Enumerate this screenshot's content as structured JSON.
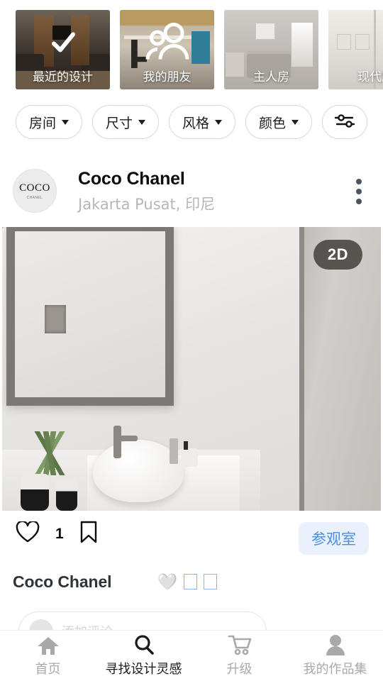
{
  "categories": [
    {
      "label": "最近的设计",
      "overlay_icon": "check-icon",
      "scene": "living-room"
    },
    {
      "label": "我的朋友",
      "overlay_icon": "people-group-icon",
      "scene": "attic-room"
    },
    {
      "label": "主人房",
      "overlay_icon": "none",
      "scene": "master-bedroom"
    },
    {
      "label": "现代厨",
      "overlay_icon": "none",
      "scene": "modern-kitchen"
    }
  ],
  "filters": [
    {
      "label": "房间",
      "has_caret": true
    },
    {
      "label": "尺寸",
      "has_caret": true
    },
    {
      "label": "风格",
      "has_caret": true
    },
    {
      "label": "颜色",
      "has_caret": true
    }
  ],
  "filter_icon_chip": {
    "icon": "tune-sliders-icon"
  },
  "post": {
    "avatar_text": "COCO",
    "avatar_subtext": "CHANEL",
    "author": "Coco Chanel",
    "location": "Jakarta Pusat, 印尼",
    "menu_icon": "kebab-menu-icon",
    "image_badge": "2D",
    "like_icon": "heart-outline-icon",
    "like_count": "1",
    "save_icon": "bookmark-outline-icon",
    "visit_button": "参观室",
    "caption_name": "Coco Chanel",
    "caption_heart": "🤍",
    "caption_tofu_count": 2
  },
  "comment": {
    "placeholder": "添加评论…",
    "avatar_icon": "user-avatar-icon"
  },
  "bottom_nav": [
    {
      "label": "首页",
      "icon": "home-icon",
      "active": false
    },
    {
      "label": "寻找设计灵感",
      "icon": "search-icon",
      "active": true
    },
    {
      "label": "升级",
      "icon": "cart-icon",
      "active": false
    },
    {
      "label": "我的作品集",
      "icon": "person-icon",
      "active": false
    }
  ],
  "colors": {
    "accent_blue": "#4a90e8",
    "accent_blue_bg": "#e9f1fd",
    "nav_inactive": "#a9a9a9",
    "nav_active": "#1a1a1a",
    "kebab": "#4a5560"
  }
}
